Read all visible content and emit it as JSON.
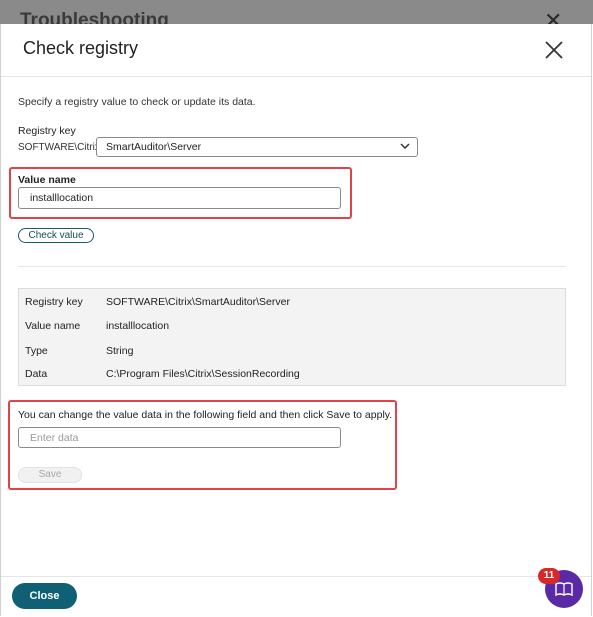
{
  "backdrop": {
    "title": "Troubleshooting"
  },
  "dialog": {
    "title": "Check registry",
    "intro": "Specify a registry value to check or update its data.",
    "registry_key_label": "Registry key",
    "registry_key_prefix": "SOFTWARE\\Citrix\\",
    "registry_key_selected": "SmartAuditor\\Server",
    "value_name_label": "Value name",
    "value_name_value": "installlocation",
    "check_button": "Check value",
    "result": [
      {
        "label": "Registry key",
        "value": "SOFTWARE\\Citrix\\SmartAuditor\\Server"
      },
      {
        "label": "Value name",
        "value": "installlocation"
      },
      {
        "label": "Type",
        "value": "String"
      },
      {
        "label": "Data",
        "value": "C:\\Program Files\\Citrix\\SessionRecording"
      }
    ],
    "change_text": "You can change the value data in the following field and then click Save to apply.",
    "data_placeholder": "Enter data",
    "save_button": "Save",
    "close_button": "Close"
  },
  "help": {
    "badge_count": "11"
  },
  "colors": {
    "primary": "#0f6074",
    "highlight": "#e0444a",
    "help_fab": "#5a2aa6",
    "badge": "#d62a2a"
  },
  "icons": {
    "close": "close-icon",
    "dropdown": "chevron-down-icon",
    "help": "help-icon"
  }
}
